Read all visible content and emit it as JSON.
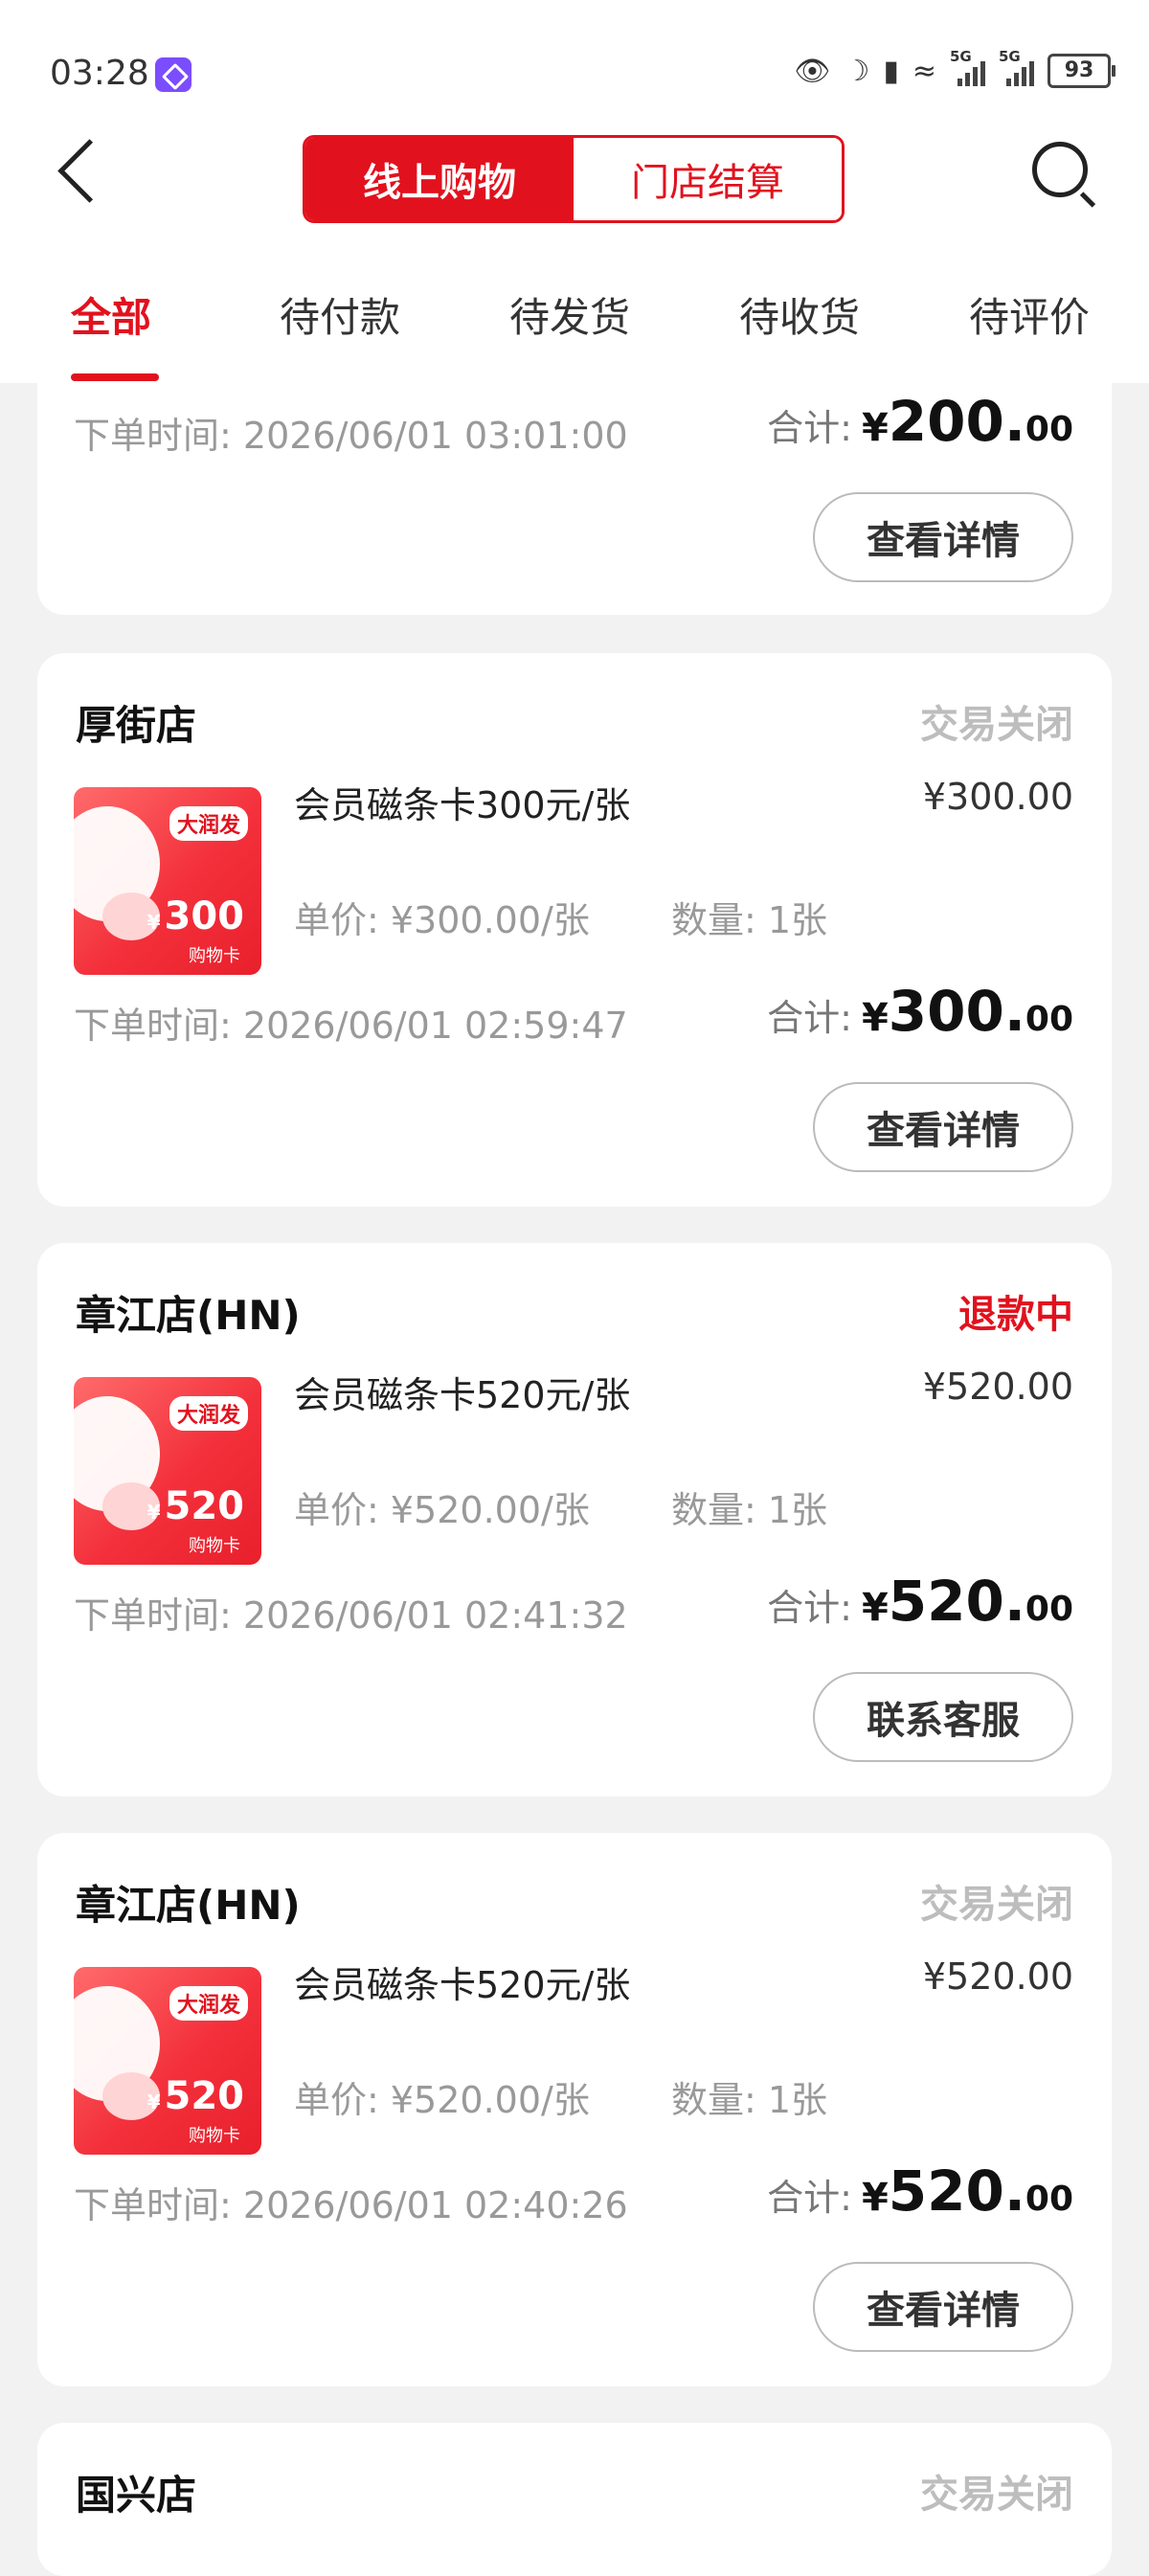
{
  "status_bar": {
    "time": "03:28",
    "battery": "93"
  },
  "header": {
    "seg_online": "线上购物",
    "seg_store": "门店结算"
  },
  "tabs": [
    "全部",
    "待付款",
    "待发货",
    "待收货",
    "待评价"
  ],
  "partial_order": {
    "time_label": "下单时间:",
    "time": "2026/06/01 03:01:00",
    "total_label": "合计:",
    "currency": "¥",
    "total_int": "200.",
    "total_dec": "00",
    "button": "查看详情"
  },
  "orders": [
    {
      "store": "厚街店",
      "status": "交易关闭",
      "product": "会员磁条卡300元/张",
      "price": "¥300.00",
      "unit_price": "单价: ¥300.00/张",
      "quantity": "数量: 1张",
      "time_label": "下单时间:",
      "time": "2026/06/01 02:59:47",
      "total_label": "合计:",
      "currency": "¥",
      "total_int": "300.",
      "total_dec": "00",
      "button": "查看详情",
      "card_value": "300",
      "card_yen": "¥",
      "card_sub": "购物卡",
      "card_logo": "大润发"
    },
    {
      "store": "章江店(HN)",
      "status": "退款中",
      "product": "会员磁条卡520元/张",
      "price": "¥520.00",
      "unit_price": "单价: ¥520.00/张",
      "quantity": "数量: 1张",
      "time_label": "下单时间:",
      "time": "2026/06/01 02:41:32",
      "total_label": "合计:",
      "currency": "¥",
      "total_int": "520.",
      "total_dec": "00",
      "button": "联系客服",
      "card_value": "520",
      "card_yen": "¥",
      "card_sub": "购物卡",
      "card_logo": "大润发"
    },
    {
      "store": "章江店(HN)",
      "status": "交易关闭",
      "product": "会员磁条卡520元/张",
      "price": "¥520.00",
      "unit_price": "单价: ¥520.00/张",
      "quantity": "数量: 1张",
      "time_label": "下单时间:",
      "time": "2026/06/01 02:40:26",
      "total_label": "合计:",
      "currency": "¥",
      "total_int": "520.",
      "total_dec": "00",
      "button": "查看详情",
      "card_value": "520",
      "card_yen": "¥",
      "card_sub": "购物卡",
      "card_logo": "大润发"
    },
    {
      "store": "国兴店",
      "status": "交易关闭"
    }
  ],
  "colors": {
    "accent": "#e1121e",
    "closed": "#bdbdbd",
    "muted": "#999999"
  }
}
